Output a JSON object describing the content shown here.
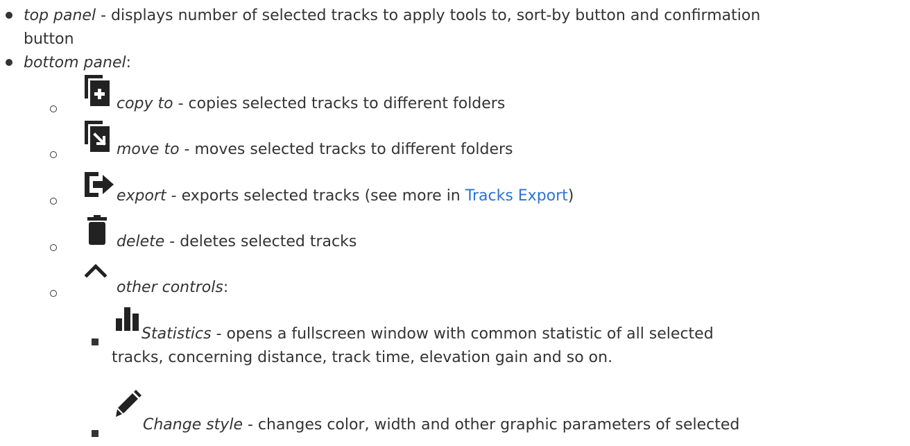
{
  "items": {
    "top_panel": {
      "name": "top panel",
      "text_line1": " - displays number of selected tracks to apply tools to, sort-by button and confirmation",
      "text_line2": "button"
    },
    "bottom_panel": {
      "name": "bottom panel",
      "suffix": ":"
    },
    "copy_to": {
      "icon": "copy-add-icon",
      "name": "copy to",
      "text": " - copies selected tracks to different folders"
    },
    "move_to": {
      "icon": "move-to-folder-icon",
      "name": "move to",
      "text": " - moves selected tracks to different folders"
    },
    "export": {
      "icon": "export-icon",
      "name": "export",
      "text_before": " - exports selected tracks (see more in ",
      "link": "Tracks Export",
      "text_after": ")"
    },
    "delete": {
      "icon": "trash-icon",
      "name": "delete",
      "text": " - deletes selected tracks"
    },
    "other_controls": {
      "icon": "chevron-up-icon",
      "name": "other controls",
      "suffix": ":"
    },
    "statistics": {
      "icon": "bar-chart-icon",
      "name": "Statistics",
      "text_line1": " - opens a fullscreen window with common statistic of all selected",
      "text_line2": "tracks, concerning distance, track time, elevation gain and so on."
    },
    "change_style": {
      "icon": "pencil-icon",
      "name": "Change style",
      "text": " - changes color, width and other graphic parameters of selected"
    }
  },
  "colors": {
    "text": "#333333",
    "link": "#2b73d2"
  }
}
